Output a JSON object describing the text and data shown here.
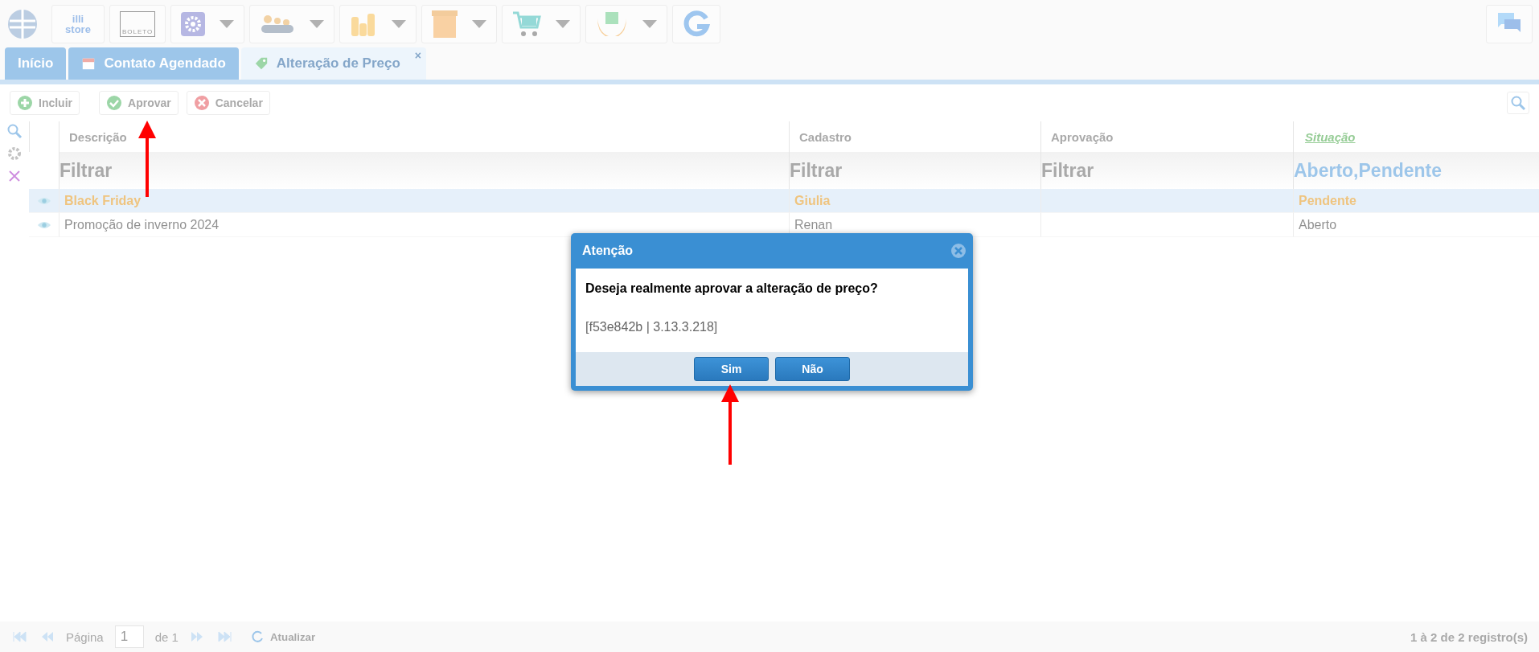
{
  "toolbar": {
    "apps": [
      {
        "kind": "logo",
        "dropdown": false
      },
      {
        "kind": "store",
        "label": "illi store",
        "dropdown": false
      },
      {
        "kind": "boleto",
        "label": "BOLETO",
        "dropdown": false
      },
      {
        "kind": "settings",
        "dropdown": true
      },
      {
        "kind": "people",
        "dropdown": true
      },
      {
        "kind": "coins",
        "dropdown": true
      },
      {
        "kind": "box",
        "dropdown": true
      },
      {
        "kind": "cart",
        "dropdown": true
      },
      {
        "kind": "hands",
        "dropdown": true
      },
      {
        "kind": "refresh",
        "dropdown": false
      }
    ],
    "chat": {
      "kind": "chat"
    }
  },
  "tabs": [
    {
      "label": "Início",
      "selected": false
    },
    {
      "label": "Contato Agendado",
      "selected": false
    },
    {
      "label": "Alteração de Preço",
      "selected": true,
      "close": "×"
    }
  ],
  "actions": [
    {
      "kind": "add",
      "label": "Incluir"
    },
    {
      "kind": "approve",
      "label": "Aprovar"
    },
    {
      "kind": "cancel",
      "label": "Cancelar"
    }
  ],
  "table": {
    "columns": [
      {
        "label": "Descrição",
        "filtered": false,
        "filter": {
          "placeholder": "Filtrar"
        }
      },
      {
        "label": "Cadastro",
        "filtered": false,
        "filter": {
          "placeholder": "Filtrar"
        }
      },
      {
        "label": "Aprovação",
        "filtered": false,
        "filter": {
          "placeholder": "Filtrar"
        }
      },
      {
        "label": "Situação",
        "filtered": true,
        "filter": {
          "value": "Aberto,Pendente"
        }
      }
    ],
    "rows": [
      {
        "selected": true,
        "descricao": "Black Friday",
        "cadastro": "Giulia",
        "situacao": "Pendente"
      },
      {
        "selected": false,
        "descricao": "Promoção de inverno 2024",
        "cadastro": "Renan",
        "situacao": "Aberto"
      }
    ]
  },
  "pager": {
    "page_label": "Página",
    "page": "1",
    "of": "de 1",
    "refresh": "Atualizar",
    "summary": "1 à 2 de 2 registro(s)"
  },
  "dialog": {
    "title": "Atenção",
    "message": "Deseja realmente aprovar a alteração de preço?",
    "detail": "[f53e842b | 3.13.3.218]",
    "buttons": [
      "Sim",
      "Não"
    ]
  },
  "annotations": [
    {
      "kind": "arrow"
    },
    {
      "kind": "arrow"
    }
  ]
}
